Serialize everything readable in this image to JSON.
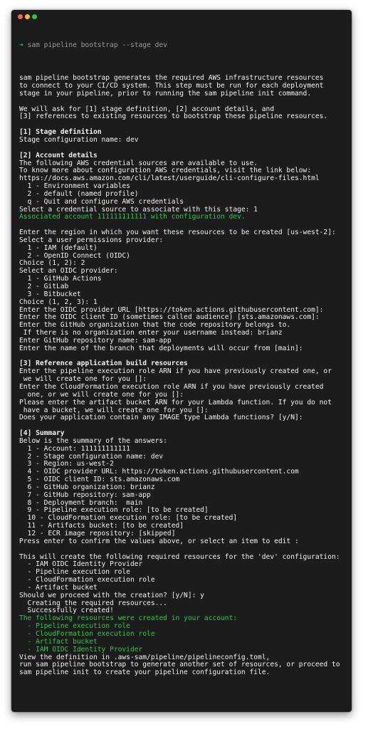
{
  "window": {
    "title_buttons": [
      "close",
      "minimize",
      "zoom"
    ]
  },
  "colors": {
    "prompt": "#29c444",
    "success": "#30c74a",
    "background": "#1c1c1c",
    "text": "#f2f2f2"
  },
  "terminal": {
    "prompt_icon": "➜",
    "command": "sam pipeline bootstrap --stage dev",
    "lines": [
      {
        "t": "sam pipeline bootstrap generates the required AWS infrastructure resources"
      },
      {
        "t": "to connect to your CI/CD system. This step must be run for each deployment"
      },
      {
        "t": "stage in your pipeline, prior to running the sam pipeline init command."
      },
      {
        "t": ""
      },
      {
        "t": "We will ask for [1] stage definition, [2] account details, and"
      },
      {
        "t": "[3] references to existing resources to bootstrap these pipeline resources."
      },
      {
        "t": ""
      },
      {
        "t": "[1] Stage definition",
        "s": "b"
      },
      {
        "t": "Stage configuration name: dev"
      },
      {
        "t": ""
      },
      {
        "t": "[2] Account details",
        "s": "b"
      },
      {
        "t": "The following AWS credential sources are available to use."
      },
      {
        "t": "To know more about configuration AWS credentials, visit the link below:"
      },
      {
        "t": "https://docs.aws.amazon.com/cli/latest/userguide/cli-configure-files.html"
      },
      {
        "t": "  1 - Environment variables"
      },
      {
        "t": "  2 - default (named profile)"
      },
      {
        "t": "  q - Quit and configure AWS credentials"
      },
      {
        "t": "Select a credential source to associate with this stage: 1"
      },
      {
        "t": "Associated account 111111111111 with configuration dev.",
        "s": "g"
      },
      {
        "t": ""
      },
      {
        "t": "Enter the region in which you want these resources to be created [us-west-2]:"
      },
      {
        "t": "Select a user permissions provider:"
      },
      {
        "t": "  1 - IAM (default)"
      },
      {
        "t": "  2 - OpenID Connect (OIDC)"
      },
      {
        "t": "Choice (1, 2): 2"
      },
      {
        "t": "Select an OIDC provider:"
      },
      {
        "t": "  1 - GitHub Actions"
      },
      {
        "t": "  2 - GitLab"
      },
      {
        "t": "  3 - Bitbucket"
      },
      {
        "t": "Choice (1, 2, 3): 1"
      },
      {
        "t": "Enter the OIDC provider URL [https://token.actions.githubusercontent.com]:"
      },
      {
        "t": "Enter the OIDC client ID (sometimes called audience) [sts.amazonaws.com]:"
      },
      {
        "t": "Enter the GitHub organization that the code repository belongs to."
      },
      {
        "t": " If there is no organization enter your username instead: brianz"
      },
      {
        "t": "Enter GitHub repository name: sam-app"
      },
      {
        "t": "Enter the name of the branch that deployments will occur from [main]:"
      },
      {
        "t": ""
      },
      {
        "t": "[3] Reference application build resources",
        "s": "b"
      },
      {
        "t": "Enter the pipeline execution role ARN if you have previously created one, or"
      },
      {
        "t": " we will create one for you []:"
      },
      {
        "t": "Enter the CloudFormation execution role ARN if you have previously created"
      },
      {
        "t": "  one, or we will create one for you []:"
      },
      {
        "t": "Please enter the artifact bucket ARN for your Lambda function. If you do not"
      },
      {
        "t": " have a bucket, we will create one for you []:"
      },
      {
        "t": "Does your application contain any IMAGE type Lambda functions? [y/N]:"
      },
      {
        "t": ""
      },
      {
        "t": "[4] Summary",
        "s": "b"
      },
      {
        "t": "Below is the summary of the answers:"
      },
      {
        "t": "  1 - Account: 111111111111"
      },
      {
        "t": "  2 - Stage configuration name: dev"
      },
      {
        "t": "  3 - Region: us-west-2"
      },
      {
        "t": "  4 - OIDC provider URL: https://token.actions.githubusercontent.com"
      },
      {
        "t": "  5 - OIDC client ID: sts.amazonaws.com"
      },
      {
        "t": "  6 - GitHub organization: brianz"
      },
      {
        "t": "  7 - GitHub repository: sam-app"
      },
      {
        "t": "  8 - Deployment branch:  main"
      },
      {
        "t": "  9 - Pipeline execution role: [to be created]"
      },
      {
        "t": "  10 - CloudFormation execution role: [to be created]"
      },
      {
        "t": "  11 - Artifacts bucket: [to be created]"
      },
      {
        "t": "  12 - ECR image repository: [skipped]"
      },
      {
        "t": "Press enter to confirm the values above, or select an item to edit :"
      },
      {
        "t": ""
      },
      {
        "t": "This will create the following required resources for the 'dev' configuration:"
      },
      {
        "t": "  - IAM OIDC Identity Provider"
      },
      {
        "t": "  - Pipeline execution role"
      },
      {
        "t": "  - CloudFormation execution role"
      },
      {
        "t": "  - Artifact bucket"
      },
      {
        "t": "Should we proceed with the creation? [y/N]: y"
      },
      {
        "t": "  Creating the required resources..."
      },
      {
        "t": "  Successfully created!"
      },
      {
        "t": "The following resources were created in your account:",
        "s": "g"
      },
      {
        "t": "  - Pipeline execution role",
        "s": "g"
      },
      {
        "t": "  - CloudFormation execution role",
        "s": "g"
      },
      {
        "t": "  - Artifact bucket",
        "s": "g"
      },
      {
        "t": "  - IAM OIDC Identity Provider",
        "s": "g"
      },
      {
        "t": "View the definition in .aws-sam/pipeline/pipelineconfig.toml,"
      },
      {
        "t": "run sam pipeline bootstrap to generate another set of resources, or proceed to"
      },
      {
        "t": "sam pipeline init to create your pipeline configuration file."
      }
    ]
  }
}
